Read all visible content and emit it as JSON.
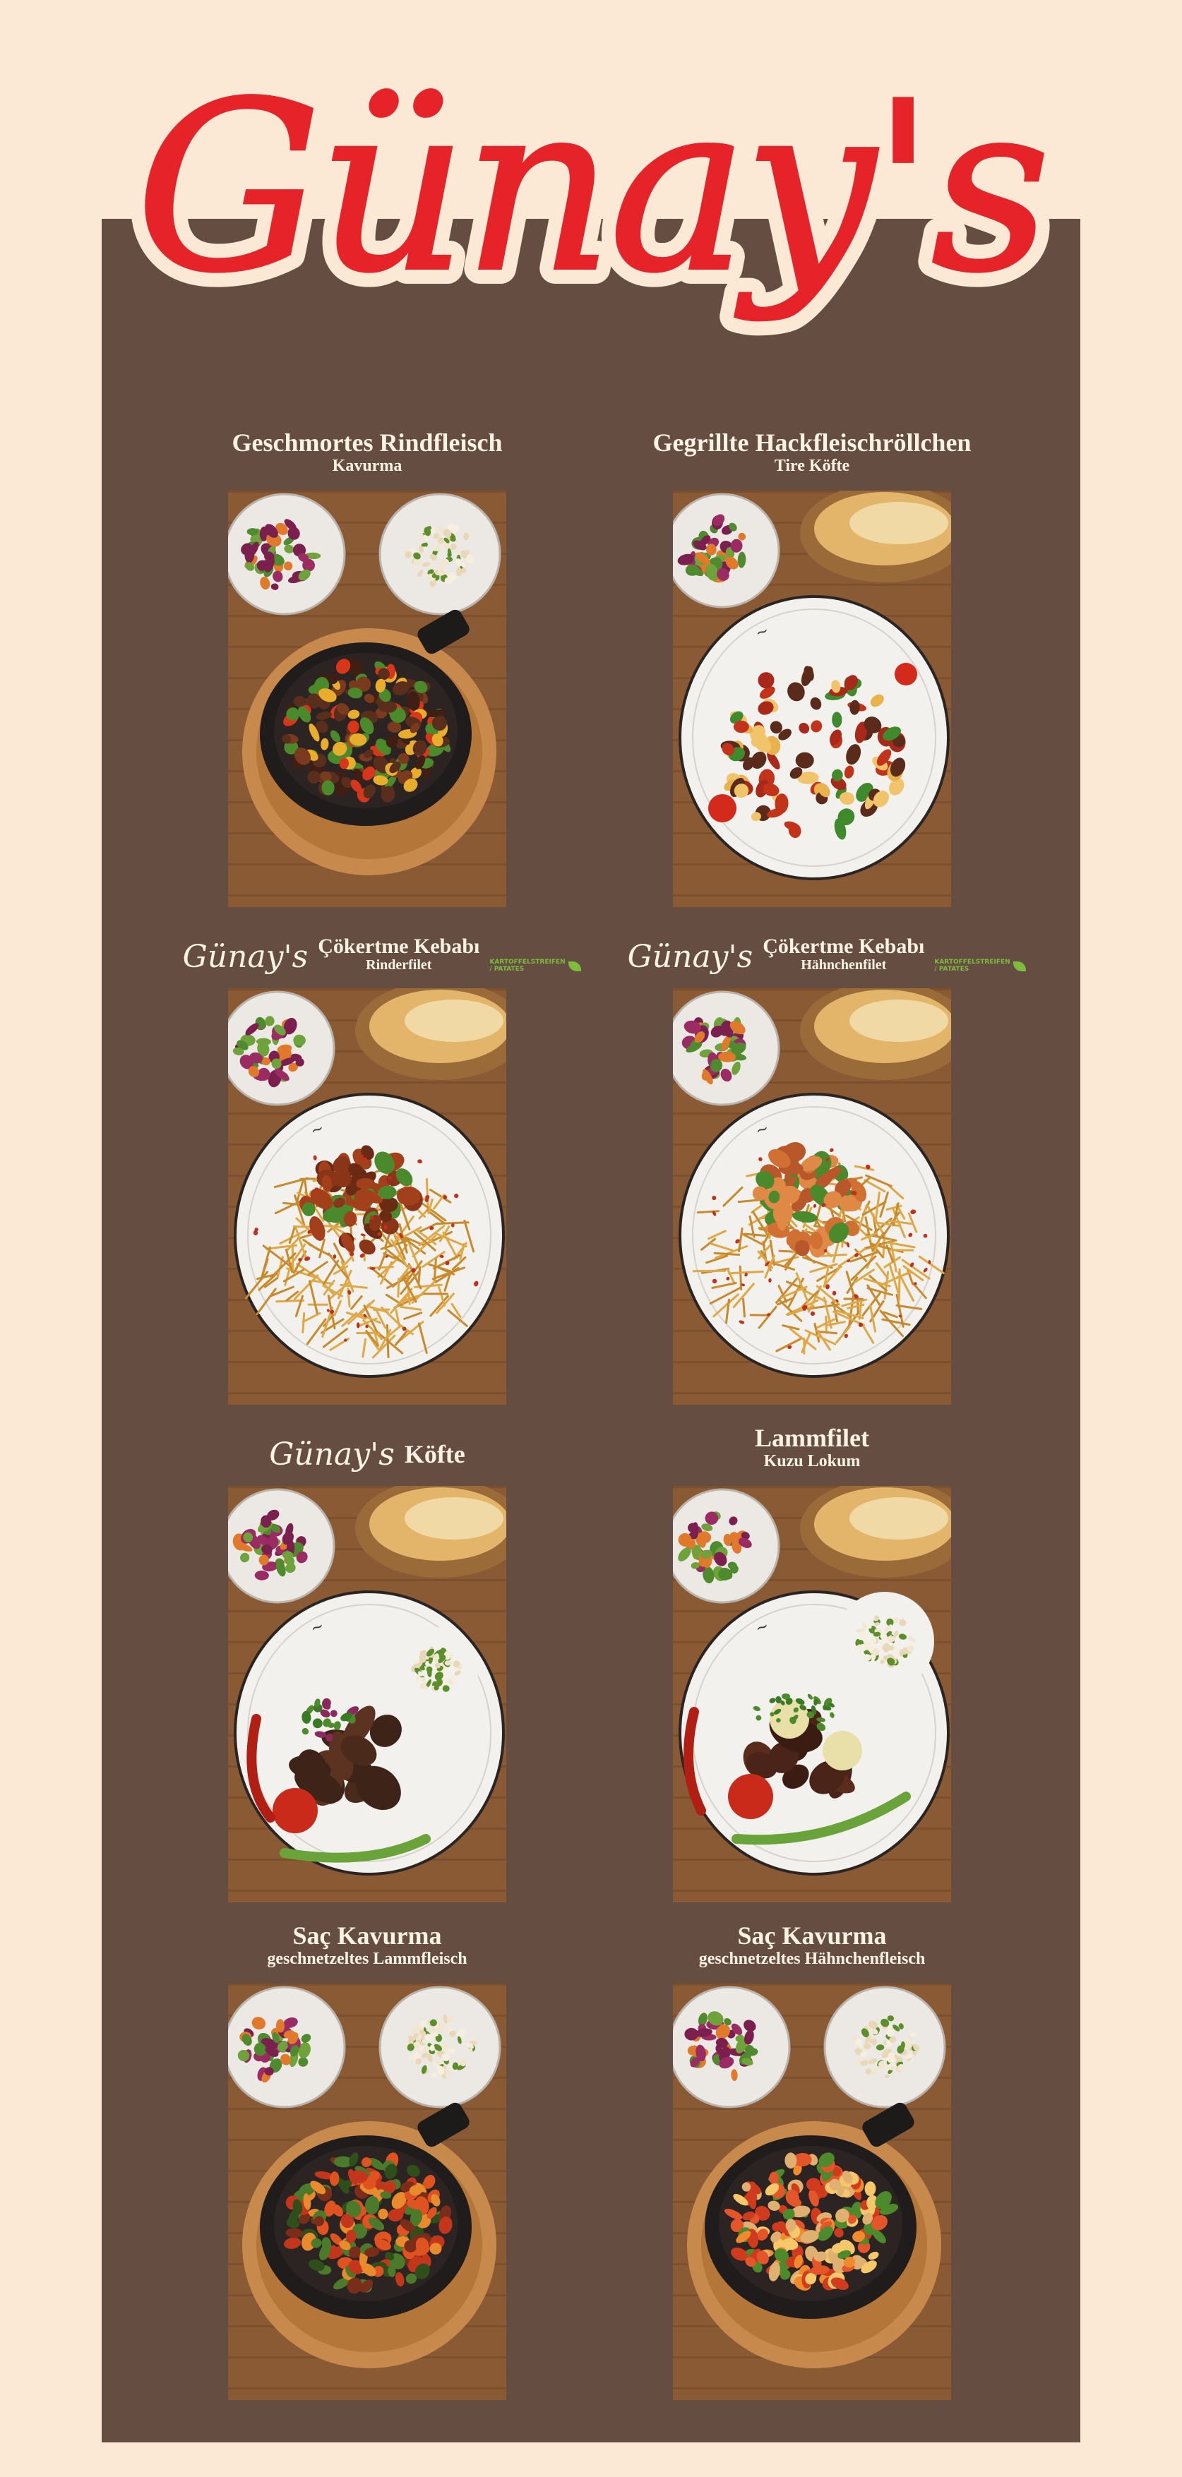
{
  "brand": {
    "logo_text": "Günay's",
    "logo_color": "#e52328",
    "background": "#fbe8d5",
    "panel_color": "#654d42",
    "text_color": "#fff3e6"
  },
  "dishes": [
    {
      "title": "Geschmortes Rindfleisch",
      "subtitle": "Kavurma",
      "dish_type": "pan-beef"
    },
    {
      "title": "Gegrillte Hackfleischröllchen",
      "subtitle": "Tire Köfte",
      "dish_type": "plate-kofte-sauce"
    },
    {
      "brand_prefix": "Günay's",
      "title": "Çökertme Kebabı",
      "subtitle": "Rinderfilet",
      "badge": "KARTOFFELSTREIFEN / PATATES",
      "dish_type": "plate-fries-beef"
    },
    {
      "brand_prefix": "Günay's",
      "title": "Çökertme Kebabı",
      "subtitle": "Hähnchenfilet",
      "badge": "KARTOFFELSTREIFEN / PATATES",
      "dish_type": "plate-fries-chicken"
    },
    {
      "brand_prefix": "Günay's",
      "title": "Köfte",
      "subtitle": "",
      "dish_type": "plate-kofte-rice"
    },
    {
      "title": "Lammfilet",
      "subtitle": "Kuzu Lokum",
      "dish_type": "plate-lamb-rice"
    },
    {
      "title": "Saç Kavurma",
      "subtitle": "geschnetzeltes Lammfleisch",
      "dish_type": "pan-lamb"
    },
    {
      "title": "Saç Kavurma",
      "subtitle": "geschnetzeltes Hähnchenfleisch",
      "dish_type": "pan-chicken"
    }
  ]
}
